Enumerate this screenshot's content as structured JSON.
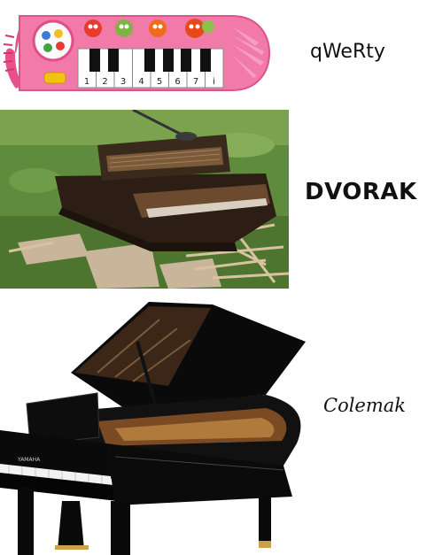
{
  "panels": [
    {
      "label": "qWeRty",
      "image": "toy-piano"
    },
    {
      "label": "DVORAK",
      "image": "wrecked-piano"
    },
    {
      "label": "Colemak",
      "image": "grand-piano"
    }
  ],
  "toy_piano": {
    "key_numbers": [
      "1",
      "2",
      "3",
      "4",
      "5",
      "6",
      "7",
      "i"
    ]
  },
  "grand_piano": {
    "brand": "YAMAHA"
  },
  "colors": {
    "toy_body": "#f06aa0",
    "grass": "#5d8a3a",
    "piano_black": "#0a0a0a",
    "wood": "#8a5a2b"
  }
}
